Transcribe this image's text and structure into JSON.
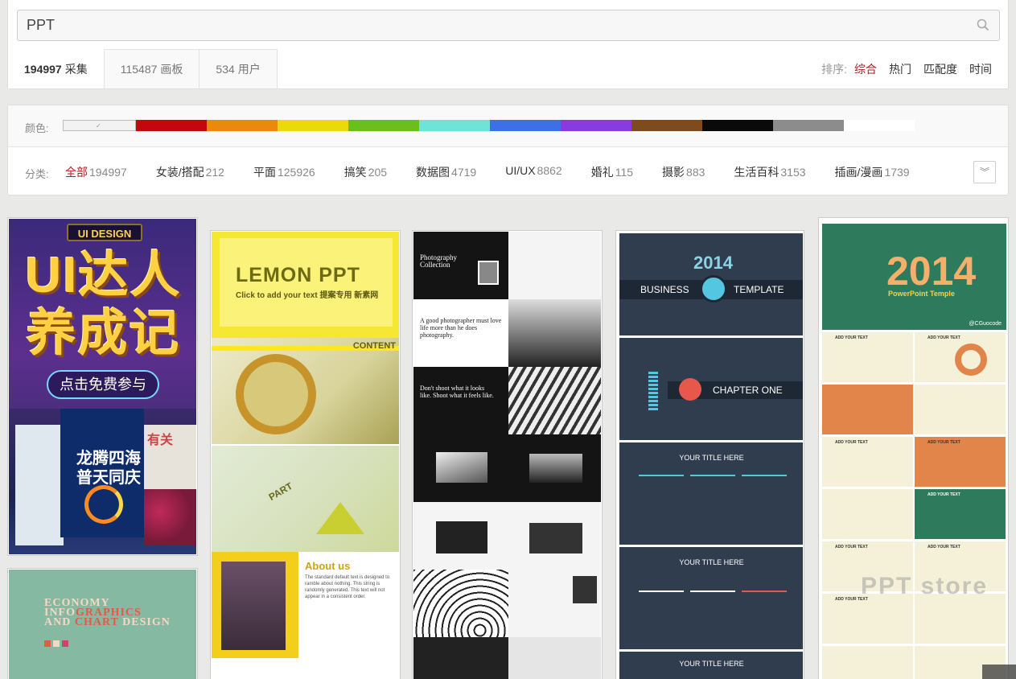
{
  "search": {
    "value": "PPT"
  },
  "tabs": [
    {
      "count": "194997",
      "label": "采集",
      "active": true
    },
    {
      "count": "115487",
      "label": "画板"
    },
    {
      "count": "534",
      "label": "用户"
    }
  ],
  "sort": {
    "label": "排序:",
    "items": [
      "综合",
      "热门",
      "匹配度",
      "时间"
    ],
    "active": "综合"
  },
  "filters": {
    "color_label": "颜色:",
    "colors": [
      "#c3070d",
      "#e98a0c",
      "#ecd90d",
      "#6abf1d",
      "#6fe3d6",
      "#3d6fe5",
      "#8a3be0",
      "#7f4a1c",
      "#0a0a0a",
      "#8c8c8c",
      "#ffffff"
    ],
    "category_label": "分类:",
    "categories": [
      {
        "name": "全部",
        "count": "194997",
        "active": true
      },
      {
        "name": "女装/搭配",
        "count": "212"
      },
      {
        "name": "平面",
        "count": "125926"
      },
      {
        "name": "搞笑",
        "count": "205"
      },
      {
        "name": "数据图",
        "count": "4719"
      },
      {
        "name": "UI/UX",
        "count": "8862"
      },
      {
        "name": "婚礼",
        "count": "115"
      },
      {
        "name": "摄影",
        "count": "883"
      },
      {
        "name": "生活百科",
        "count": "3153"
      },
      {
        "name": "插画/漫画",
        "count": "1739"
      }
    ]
  },
  "pins": {
    "ui_design": {
      "badge": "UI DESIGN",
      "title_line1": "UI达人",
      "title_line2": "养成记",
      "cta": "点击免费参与",
      "cover_title": "龙腾四海\n普天同庆",
      "side_text": "有关"
    },
    "economy": {
      "line1": "ECONOMY",
      "line2_a": "INFO",
      "line2_b": "GRAPHICS",
      "line3_a": "AND ",
      "line3_b": "CHART",
      "line3_c": " DESIGN"
    },
    "lemon": {
      "title": "LEMON PPT",
      "subtitle": "Click to add your text  提案专用 新素网",
      "content": "CONTENT",
      "part": "PART",
      "about": "About us",
      "about_text": "The standard default text is designed to ramble about nothing. This string is randomly generated. This text will not appear in a consistent order."
    },
    "photography": {
      "title": "Photography\nCollection",
      "quote1": "A good photographer must love life more than he does photography.",
      "quote2": "Don't shoot what it looks like. Shoot what it feels like."
    },
    "business": {
      "year": "2014",
      "left": "BUSINESS",
      "right": "TEMPLATE",
      "chapter": "CHAPTER ONE",
      "your_title": "YOUR TITLE HERE"
    },
    "ppt2014": {
      "year": "2014",
      "subtitle": "PowerPoint Temple",
      "credit": "@CGuocode",
      "tile_heading": "ADD YOUR TEXT"
    }
  },
  "watermark": "PPT store"
}
